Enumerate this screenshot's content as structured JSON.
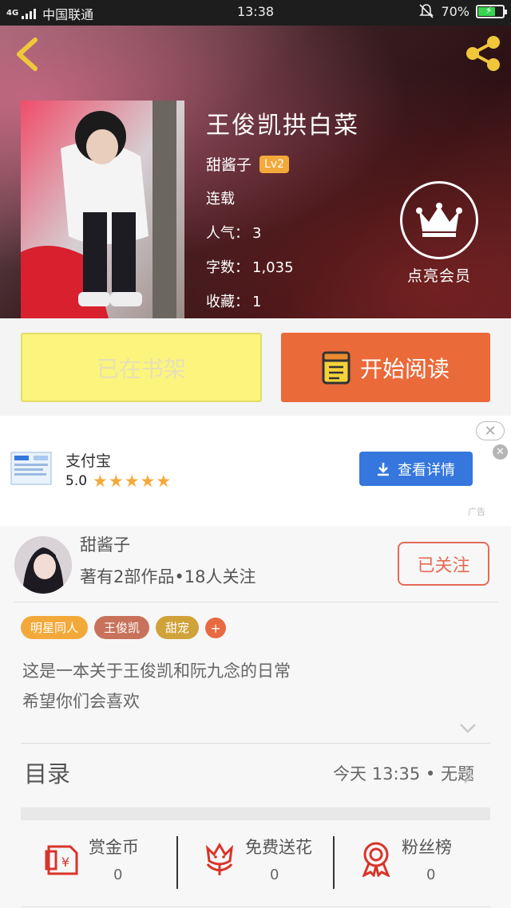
{
  "status_bar": {
    "network": "4G",
    "carrier": "中国联通",
    "time": "13:38",
    "battery": "70%"
  },
  "book": {
    "title": "王俊凯拱白菜",
    "author": "甜酱子",
    "level": "Lv2",
    "status": "连载",
    "popularity_label": "人气：",
    "popularity": "3",
    "wordcount_label": "字数：",
    "wordcount": "1,035",
    "favorites_label": "收藏：",
    "favorites": "1"
  },
  "member": {
    "label": "点亮会员"
  },
  "actions": {
    "shelf_label": "已在书架",
    "read_label": "开始阅读"
  },
  "ad": {
    "app_name": "支付宝",
    "rating": "5.0",
    "stars": "★★★★★",
    "button_label": "查看详情",
    "tag": "广告"
  },
  "author_section": {
    "name": "甜酱子",
    "stats": "著有2部作品•18人关注",
    "follow_label": "已关注",
    "tags": [
      {
        "label": "明星同人",
        "color": "#f3a93a"
      },
      {
        "label": "王俊凯",
        "color": "#c8725b"
      },
      {
        "label": "甜宠",
        "color": "#d0a23a"
      }
    ],
    "tag_add": "+",
    "description": [
      "这是一本关于王俊凯和阮九念的日常",
      "希望你们会喜欢"
    ]
  },
  "toc": {
    "label": "目录",
    "latest": "今天 13:35 • 无题"
  },
  "bottom_actions": [
    {
      "label": "赏金币",
      "value": "0",
      "icon": "gold-coin-reward-icon"
    },
    {
      "label": "免费送花",
      "value": "0",
      "icon": "flower-icon"
    },
    {
      "label": "粉丝榜",
      "value": "0",
      "icon": "award-ribbon-icon"
    }
  ],
  "colors": {
    "accent_orange": "#ea6a3a",
    "shelf_yellow": "#fbf57e",
    "level_badge": "#f3a93a",
    "ad_button_blue": "#3577dd",
    "follow_red": "#e66a56"
  }
}
